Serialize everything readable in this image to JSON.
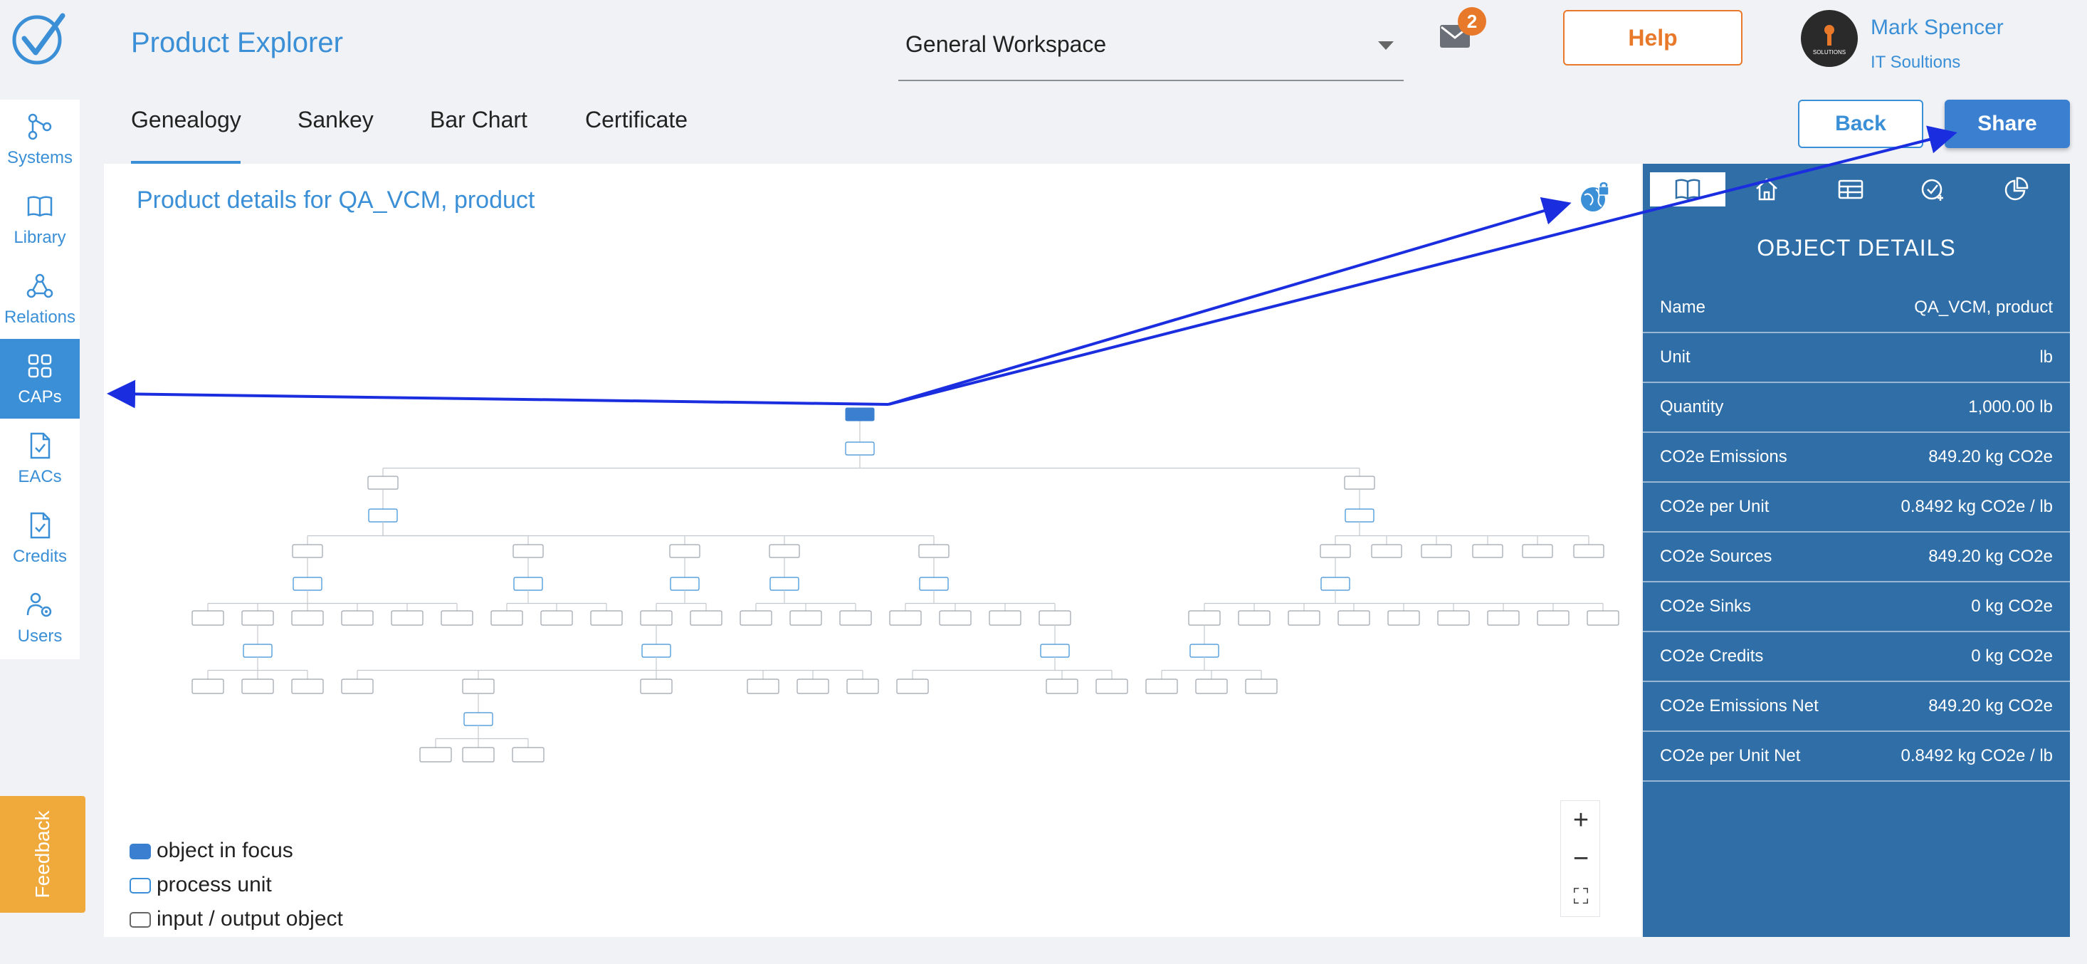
{
  "header": {
    "title": "Product Explorer",
    "workspace": "General Workspace",
    "mail_badge": "2",
    "help_label": "Help",
    "user_name": "Mark Spencer",
    "user_org": "IT Soultions",
    "avatar_text": "SOLUTIONS"
  },
  "sidebar": {
    "items": [
      {
        "label": "Systems",
        "icon": "systems-icon"
      },
      {
        "label": "Library",
        "icon": "book-icon"
      },
      {
        "label": "Relations",
        "icon": "relations-icon"
      },
      {
        "label": "CAPs",
        "icon": "grid-icon"
      },
      {
        "label": "EACs",
        "icon": "document-check-icon"
      },
      {
        "label": "Credits",
        "icon": "document-check-icon"
      },
      {
        "label": "Users",
        "icon": "users-gear-icon"
      }
    ],
    "active_index": 3,
    "feedback_label": "Feedback"
  },
  "tabs": [
    {
      "label": "Genealogy",
      "active": true
    },
    {
      "label": "Sankey",
      "active": false
    },
    {
      "label": "Bar Chart",
      "active": false
    },
    {
      "label": "Certificate",
      "active": false
    }
  ],
  "actions": {
    "back_label": "Back",
    "share_label": "Share"
  },
  "main": {
    "title": "Product details for QA_VCM, product",
    "zoom_in": "+",
    "zoom_out": "−",
    "fullscreen": "⛶",
    "legend": [
      {
        "label": "object in focus",
        "color": "#3a7fd0"
      },
      {
        "label": "process unit",
        "color": "#3a8fd6"
      },
      {
        "label": "input / output object",
        "color": "#666666"
      }
    ]
  },
  "details": {
    "tabs": [
      "book-icon",
      "home-icon",
      "table-icon",
      "check-plus-icon",
      "pie-icon"
    ],
    "title": "OBJECT DETAILS",
    "rows": [
      {
        "key": "Name",
        "value": "QA_VCM, product"
      },
      {
        "key": "Unit",
        "value": "lb"
      },
      {
        "key": "Quantity",
        "value": "1,000.00 lb"
      },
      {
        "key": "CO2e Emissions",
        "value": "849.20 kg CO2e"
      },
      {
        "key": "CO2e per Unit",
        "value": "0.8492 kg CO2e / lb"
      },
      {
        "key": "CO2e Sources",
        "value": "849.20 kg CO2e"
      },
      {
        "key": "CO2e Sinks",
        "value": "0 kg CO2e"
      },
      {
        "key": "CO2e Credits",
        "value": "0 kg CO2e"
      },
      {
        "key": "CO2e Emissions Net",
        "value": "849.20 kg CO2e"
      },
      {
        "key": "CO2e per Unit Net",
        "value": "0.8492 kg CO2e / lb"
      }
    ]
  },
  "colors": {
    "primary": "#3a8fd6",
    "panel": "#2f6ea6",
    "accent": "#e8792a",
    "feedback": "#f0a93b",
    "arrow": "#1a2ee0"
  }
}
